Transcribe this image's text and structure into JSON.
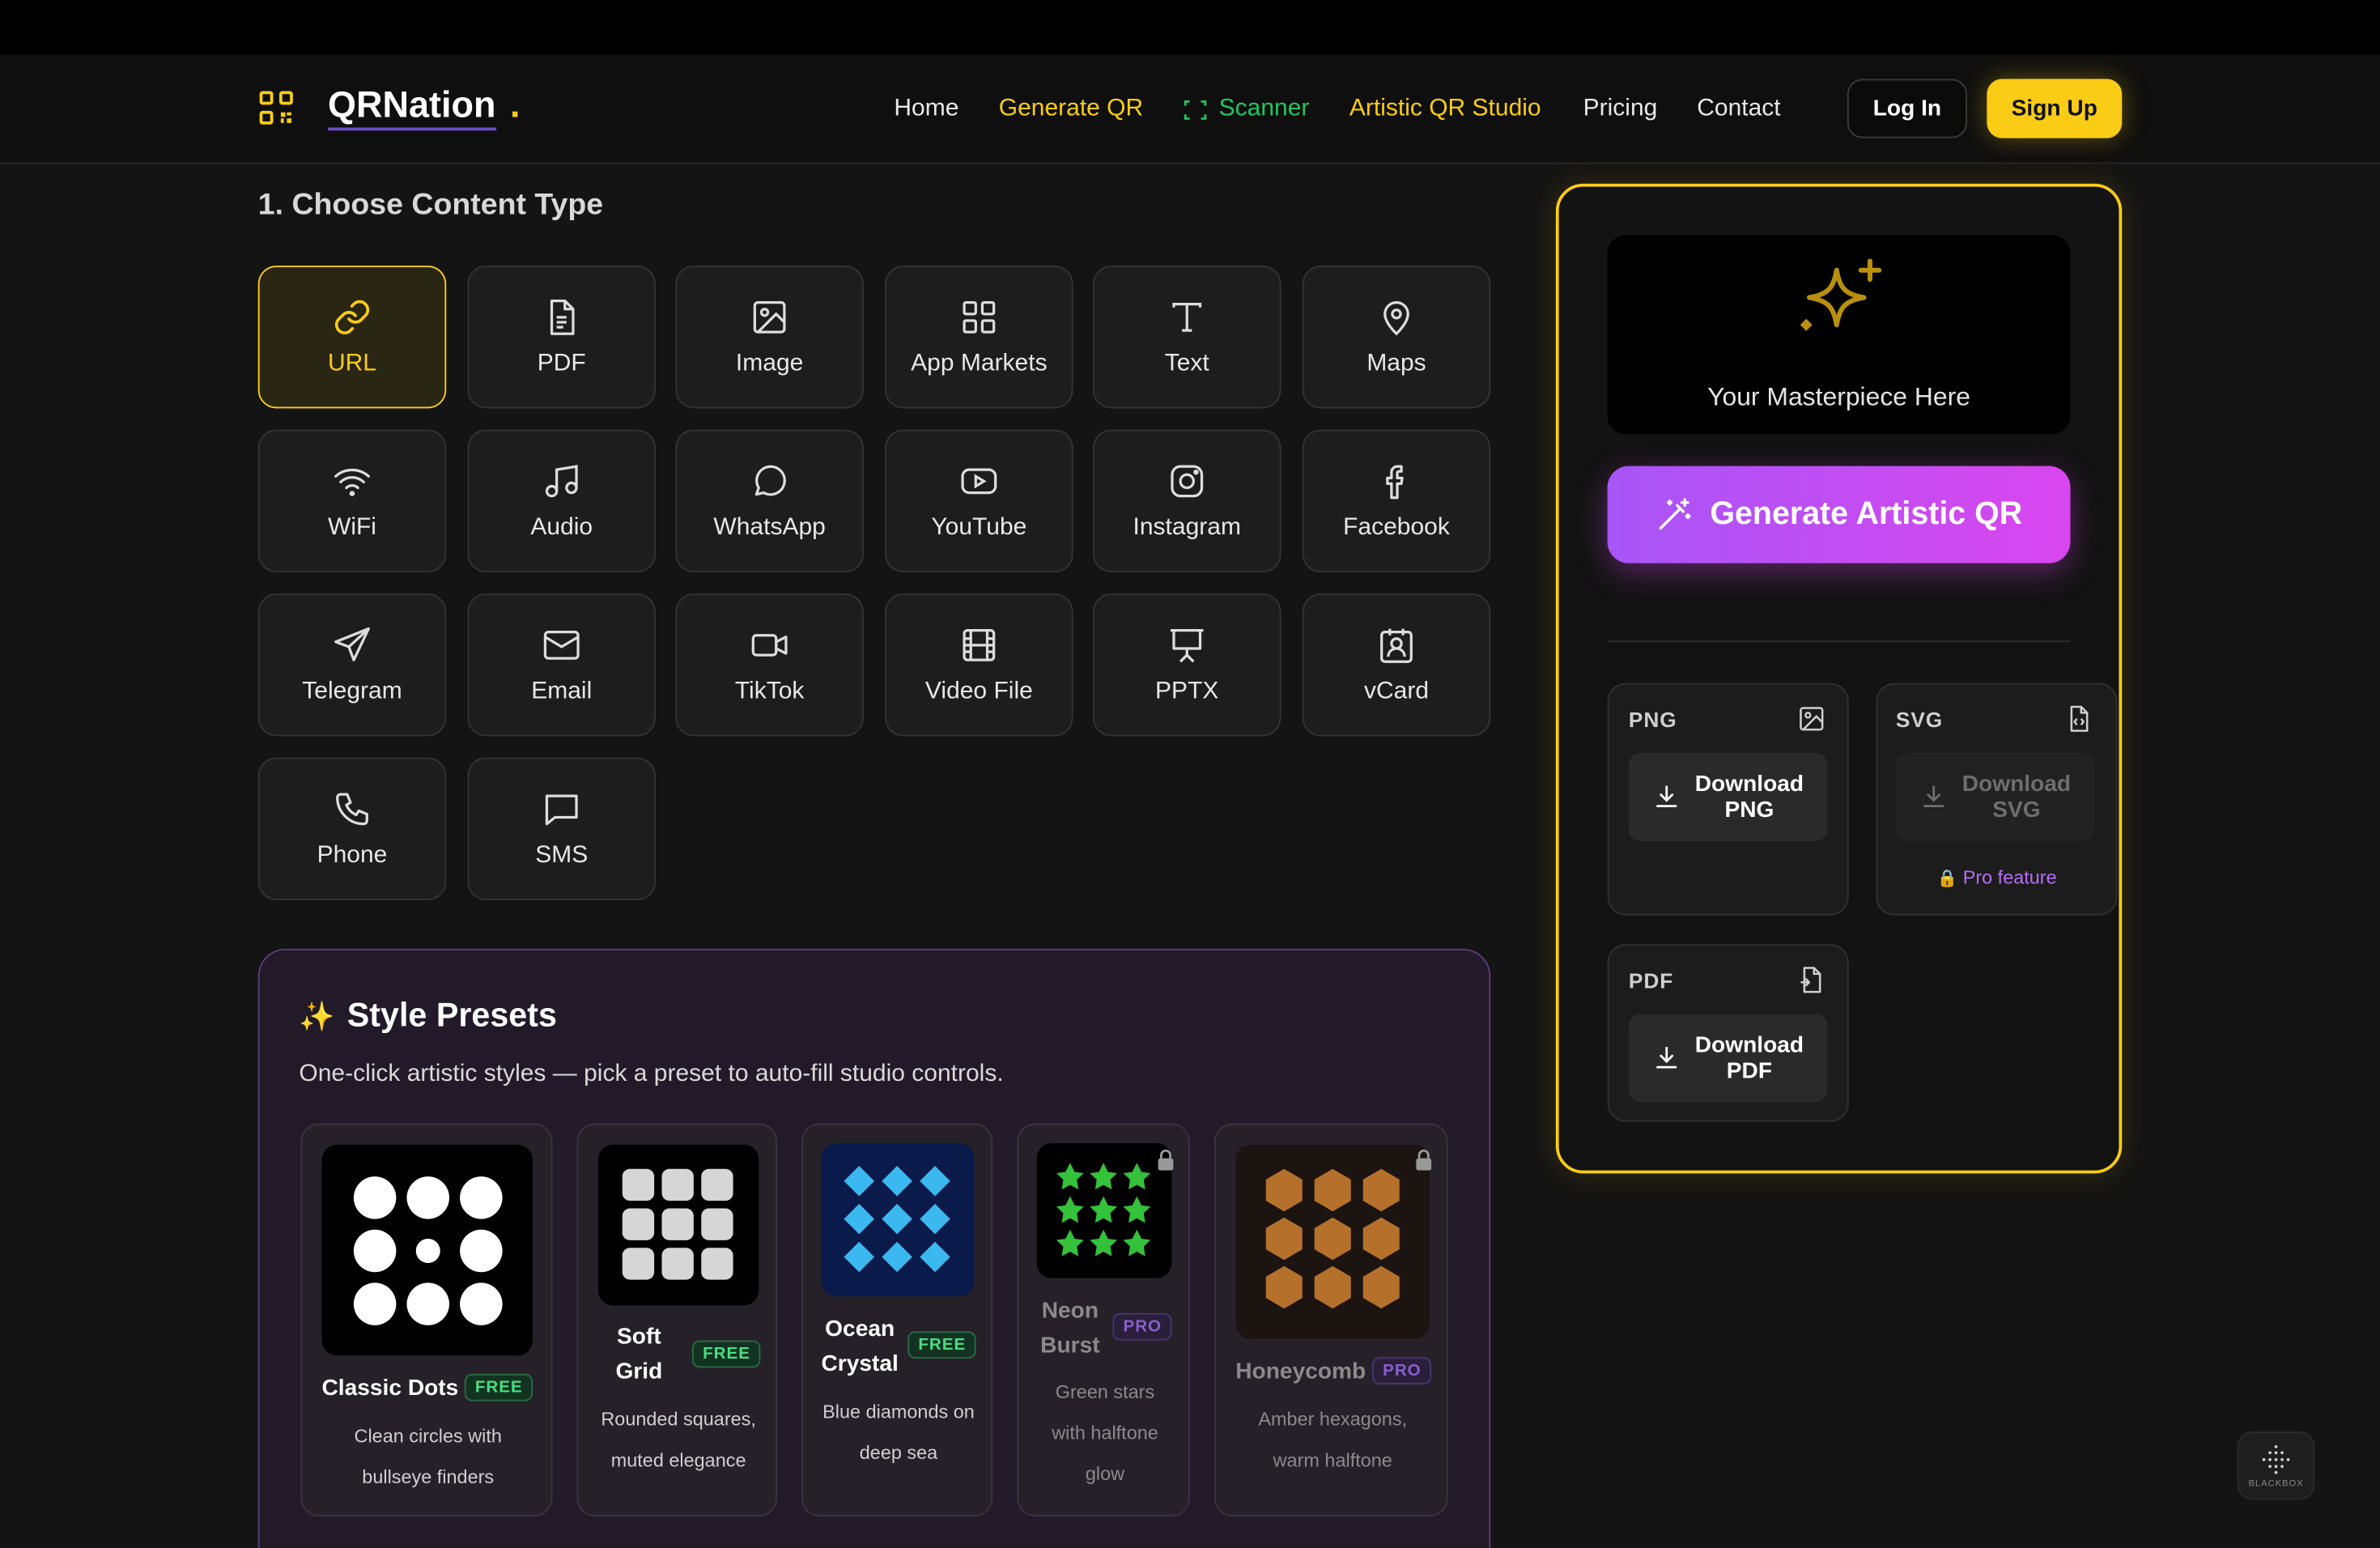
{
  "brand": {
    "name": "QRNation",
    "dot": ".",
    "accent": "#facc15"
  },
  "nav": {
    "links": [
      {
        "label": "Home",
        "color": "#e8e8e8"
      },
      {
        "label": "Generate QR",
        "color": "#facc15"
      },
      {
        "label": "Scanner",
        "color": "#22c55e",
        "icon": "scan-icon"
      },
      {
        "label": "Artistic QR Studio",
        "color": "#facc15"
      },
      {
        "label": "Pricing",
        "color": "#e8e8e8"
      },
      {
        "label": "Contact",
        "color": "#e8e8e8"
      }
    ],
    "login": "Log In",
    "signup": "Sign Up"
  },
  "content_type": {
    "title": "1. Choose Content Type",
    "selected": "URL",
    "items": [
      {
        "label": "URL",
        "icon": "link-icon"
      },
      {
        "label": "PDF",
        "icon": "document-icon"
      },
      {
        "label": "Image",
        "icon": "image-icon"
      },
      {
        "label": "App Markets",
        "icon": "grid-icon"
      },
      {
        "label": "Text",
        "icon": "text-icon"
      },
      {
        "label": "Maps",
        "icon": "map-pin-icon"
      },
      {
        "label": "WiFi",
        "icon": "wifi-icon"
      },
      {
        "label": "Audio",
        "icon": "music-icon"
      },
      {
        "label": "WhatsApp",
        "icon": "chat-bubble-icon"
      },
      {
        "label": "YouTube",
        "icon": "youtube-icon"
      },
      {
        "label": "Instagram",
        "icon": "instagram-icon"
      },
      {
        "label": "Facebook",
        "icon": "facebook-icon"
      },
      {
        "label": "Telegram",
        "icon": "send-icon"
      },
      {
        "label": "Email",
        "icon": "mail-icon"
      },
      {
        "label": "TikTok",
        "icon": "video-camera-icon"
      },
      {
        "label": "Video File",
        "icon": "film-icon"
      },
      {
        "label": "PPTX",
        "icon": "presentation-icon"
      },
      {
        "label": "vCard",
        "icon": "contact-card-icon"
      },
      {
        "label": "Phone",
        "icon": "phone-icon"
      },
      {
        "label": "SMS",
        "icon": "message-square-icon"
      }
    ]
  },
  "presets": {
    "title_icon": "✨",
    "title": "Style Presets",
    "subtitle": "One-click artistic styles — pick a preset to auto-fill studio controls.",
    "items": [
      {
        "name": "Classic Dots",
        "badge": "FREE",
        "desc": [
          "Clean circles with",
          "bullseye finders"
        ],
        "locked": false
      },
      {
        "name": "Soft Grid",
        "badge": "FREE",
        "desc": [
          "Rounded squares,",
          "muted elegance"
        ],
        "locked": false
      },
      {
        "name": "Ocean Crystal",
        "badge": "FREE",
        "desc": [
          "Blue diamonds on",
          "deep sea"
        ],
        "locked": false
      },
      {
        "name": "Neon Burst",
        "badge": "PRO",
        "desc": [
          "Green stars",
          "with halftone",
          "glow"
        ],
        "locked": true
      },
      {
        "name": "Honeycomb",
        "badge": "PRO",
        "desc": [
          "Amber hexagons,",
          "warm halftone"
        ],
        "locked": true
      }
    ]
  },
  "studio": {
    "preview_icon": "sparkles-icon",
    "preview_text": "Your Masterpiece Here",
    "generate_label": "Generate Artistic QR",
    "downloads": [
      {
        "format": "PNG",
        "line1": "Download",
        "line2": "PNG",
        "enabled": true
      },
      {
        "format": "SVG",
        "line1": "Download",
        "line2": "SVG",
        "enabled": false,
        "note": "Pro feature"
      },
      {
        "format": "PDF",
        "line1": "Download",
        "line2": "PDF",
        "enabled": true
      }
    ]
  },
  "watermark": "BLACKBOX"
}
